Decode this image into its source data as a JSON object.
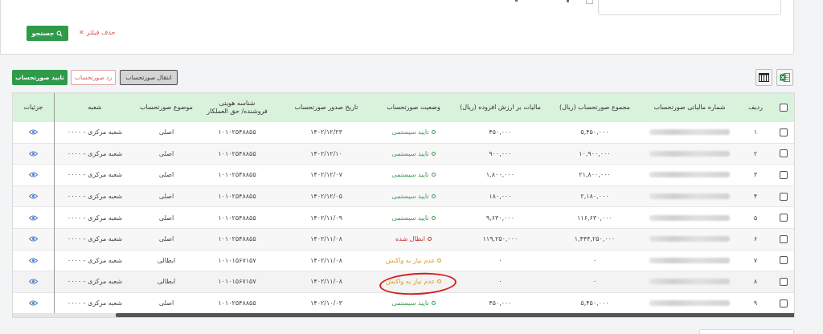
{
  "filters": {
    "search_label": "جستجو",
    "clear_label": "حذف فیلتر"
  },
  "actions": {
    "approve_label": "تایید صورتحساب",
    "reject_label": "رد صورتحساب",
    "transfer_label": "انتقال صورتحساب"
  },
  "table": {
    "headers": {
      "row_no": "ردیف",
      "tax_no": "شماره مالیاتی صورتحساب",
      "total": "مجموع صورتحساب (ریال)",
      "vat": "مالیات بر ارزش افزوده (ریال)",
      "status": "وضعیت صورتحساب",
      "issue_date": "تاریخ صدور صورتحساب",
      "seller_id_1": "شناسه هویتی",
      "seller_id_2": "فروشنده/ حق العملکار",
      "subject": "موضوع صورتحساب",
      "branch": "شعبه",
      "details": "جزئیات"
    },
    "rows": [
      {
        "no": "۱",
        "total": "۵,۴۵۰,۰۰۰",
        "vat": "۴۵۰,۰۰۰",
        "status": "تایید سیستمی",
        "status_type": "green",
        "date": "۱۴۰۲/۱۲/۲۳",
        "seller": "۱۰۱۰۲۵۴۸۸۵۵",
        "subject": "اصلی",
        "branch": "شعبه مرکزی - ۰۰۰۰"
      },
      {
        "no": "۲",
        "total": "۱۰,۹۰۰,۰۰۰",
        "vat": "۹۰۰,۰۰۰",
        "status": "تایید سیستمی",
        "status_type": "green",
        "date": "۱۴۰۲/۱۲/۱۰",
        "seller": "۱۰۱۰۲۵۴۸۸۵۵",
        "subject": "اصلی",
        "branch": "شعبه مرکزی - ۰۰۰۰"
      },
      {
        "no": "۳",
        "total": "۲۱,۸۰۰,۰۰۰",
        "vat": "۱,۸۰۰,۰۰۰",
        "status": "تایید سیستمی",
        "status_type": "green",
        "date": "۱۴۰۲/۱۲/۰۷",
        "seller": "۱۰۱۰۲۵۴۸۸۵۵",
        "subject": "اصلی",
        "branch": "شعبه مرکزی - ۰۰۰۰"
      },
      {
        "no": "۴",
        "total": "۲,۱۸۰,۰۰۰",
        "vat": "۱۸۰,۰۰۰",
        "status": "تایید سیستمی",
        "status_type": "green",
        "date": "۱۴۰۲/۱۲/۰۵",
        "seller": "۱۰۱۰۲۵۴۸۸۵۵",
        "subject": "اصلی",
        "branch": "شعبه مرکزی - ۰۰۰۰"
      },
      {
        "no": "۵",
        "total": "۱۱۶,۶۳۰,۰۰۰",
        "vat": "۹,۶۳۰,۰۰۰",
        "status": "تایید سیستمی",
        "status_type": "green",
        "date": "۱۴۰۲/۱۱/۰۹",
        "seller": "۱۰۱۰۲۵۴۸۸۵۵",
        "subject": "اصلی",
        "branch": "شعبه مرکزی - ۰۰۰۰"
      },
      {
        "no": "۶",
        "total": "۱,۴۴۴,۲۵۰,۰۰۰",
        "vat": "۱۱۹,۲۵۰,۰۰۰",
        "status": "ابطال شده",
        "status_type": "red",
        "date": "۱۴۰۲/۱۱/۰۸",
        "seller": "۱۰۱۰۲۵۴۸۸۵۵",
        "subject": "اصلی",
        "branch": "شعبه مرکزی - ۰۰۰۰"
      },
      {
        "no": "۷",
        "total": "۰",
        "vat": "۰",
        "status": "عدم نیاز به واکنش",
        "status_type": "orange",
        "date": "۱۴۰۲/۱۱/۰۸",
        "seller": "۱۰۱۰۱۵۶۷۱۵۷",
        "subject": "ابطالی",
        "branch": "شعبه مرکزی - ۰۰۰۰"
      },
      {
        "no": "۸",
        "total": "۰",
        "vat": "۰",
        "status": "عدم نیاز به واکنش",
        "status_type": "orange",
        "date": "۱۴۰۲/۱۱/۰۸",
        "seller": "۱۰۱۰۱۵۶۷۱۵۷",
        "subject": "ابطالی",
        "branch": "شعبه مرکزی - ۰۰۰۰"
      },
      {
        "no": "۹",
        "total": "۵,۴۵۰,۰۰۰",
        "vat": "۴۵۰,۰۰۰",
        "status": "تایید سیستمی",
        "status_type": "green",
        "date": "۱۴۰۲/۱۰/۰۳",
        "seller": "۱۰۱۰۲۵۴۸۸۵۵",
        "subject": "اصلی",
        "branch": "شعبه مرکزی - ۰۰۰۰"
      }
    ]
  },
  "colors": {
    "accent": "#2e9a4a",
    "header_bg": "#d9f2dc",
    "status_green": "#3a9b4e",
    "status_red": "#c9302c",
    "status_orange": "#d99a2b",
    "highlight_circle": "#d42020"
  },
  "icons": {
    "search": "search-icon",
    "clear": "close-icon",
    "columns": "columns-icon",
    "excel": "excel-icon",
    "details": "eye-icon"
  }
}
